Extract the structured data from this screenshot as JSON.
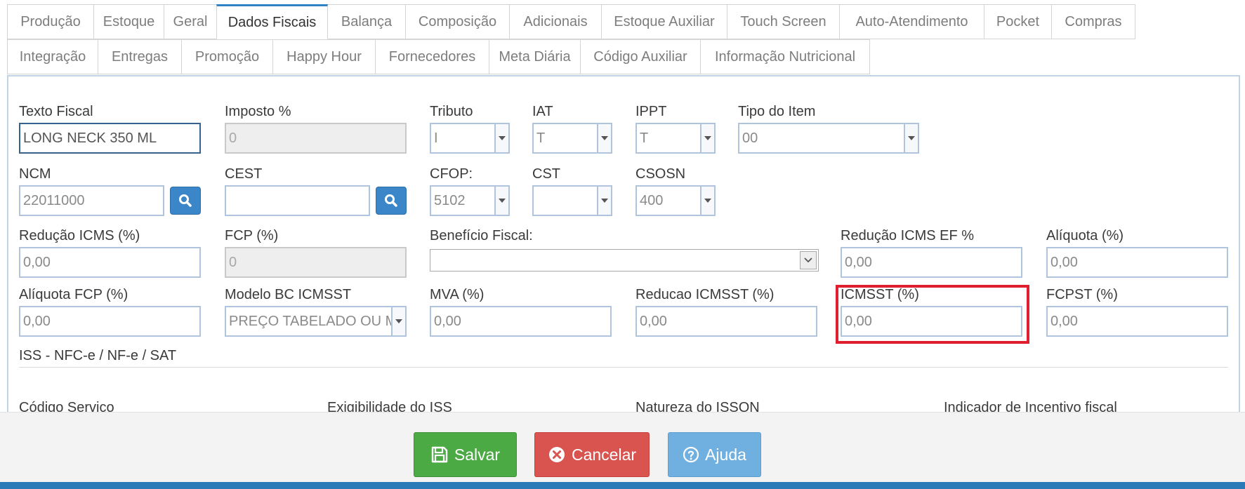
{
  "tabs_row1": [
    "Produção",
    "Estoque",
    "Geral",
    "Dados Fiscais",
    "Balança",
    "Composição",
    "Adicionais",
    "Estoque Auxiliar",
    "Touch Screen",
    "Auto-Atendimento",
    "Pocket",
    "Compras"
  ],
  "tabs_row2": [
    "Integração",
    "Entregas",
    "Promoção",
    "Happy Hour",
    "Fornecedores",
    "Meta Diária",
    "Código Auxiliar",
    "Informação Nutricional"
  ],
  "active_tab": "Dados Fiscais",
  "form": {
    "texto_fiscal": {
      "label": "Texto Fiscal",
      "value": "LONG NECK 350 ML"
    },
    "imposto": {
      "label": "Imposto %",
      "value": "0"
    },
    "tributo": {
      "label": "Tributo",
      "value": "I"
    },
    "iat": {
      "label": "IAT",
      "value": "T"
    },
    "ippt": {
      "label": "IPPT",
      "value": "T"
    },
    "tipo_item": {
      "label": "Tipo do Item",
      "value": "00"
    },
    "ncm": {
      "label": "NCM",
      "value": "22011000"
    },
    "cest": {
      "label": "CEST",
      "value": ""
    },
    "cfop": {
      "label": "CFOP:",
      "value": "5102"
    },
    "cst": {
      "label": "CST",
      "value": ""
    },
    "csosn": {
      "label": "CSOSN",
      "value": "400"
    },
    "reducao_icms": {
      "label": "Redução ICMS (%)",
      "value": "0,00"
    },
    "fcp": {
      "label": "FCP (%)",
      "value": "0"
    },
    "beneficio_fiscal": {
      "label": "Benefício Fiscal:",
      "value": ""
    },
    "reducao_icms_ef": {
      "label": "Redução ICMS EF %",
      "value": "0,00"
    },
    "aliquota": {
      "label": "Alíquota (%)",
      "value": "0,00"
    },
    "aliquota_fcp": {
      "label": "Alíquota FCP (%)",
      "value": "0,00"
    },
    "modelo_bc_icmsst": {
      "label": "Modelo BC ICMSST",
      "value": "PREÇO TABELADO OU M"
    },
    "mva": {
      "label": "MVA (%)",
      "value": "0,00"
    },
    "reducao_icmsst": {
      "label": "Reducao ICMSST (%)",
      "value": "0,00"
    },
    "icmsst": {
      "label": "ICMSST (%)",
      "value": "0,00"
    },
    "fcpst": {
      "label": "FCPST (%)",
      "value": "0,00"
    }
  },
  "iss_section": {
    "title": "ISS - NFC-e / NF-e / SAT",
    "labels": [
      "Código Serviço",
      "Exigibilidade do ISS",
      "Natureza do ISSQN",
      "Indicador de Incentivo fiscal"
    ]
  },
  "buttons": {
    "save": "Salvar",
    "cancel": "Cancelar",
    "help": "Ajuda"
  },
  "colors": {
    "save": "#4caa45",
    "cancel": "#d9534f",
    "help": "#6fb0e0",
    "highlight": "#e02030",
    "tab_active_border": "#2d83c4"
  },
  "icons": {
    "search": "search-icon",
    "save": "floppy-icon",
    "cancel": "close-circle-icon",
    "help": "question-circle-icon"
  }
}
